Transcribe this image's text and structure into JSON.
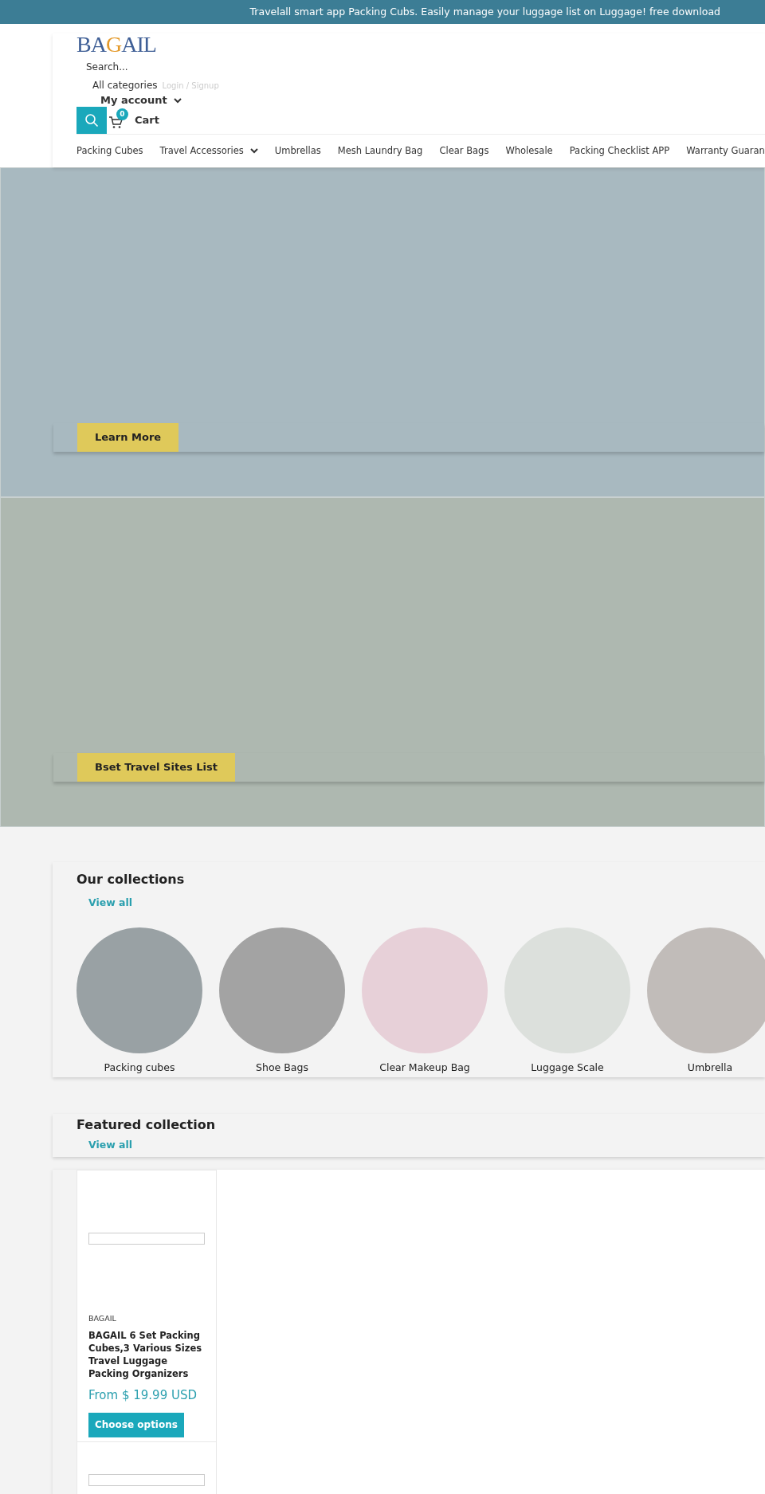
{
  "announcement": "Travelall smart app Packing Cubs. Easily manage your luggage list on Luggage! free download",
  "header": {
    "logo": "BAGAIL",
    "search": {
      "placeholder": "Search..."
    },
    "category_select": "All categories",
    "login": "Login / Signup",
    "account": "My account",
    "cart": {
      "count": "0",
      "label": "Cart"
    }
  },
  "nav": [
    {
      "label": "Packing Cubes",
      "has_menu": false
    },
    {
      "label": "Travel Accessories",
      "has_menu": true
    },
    {
      "label": "Umbrellas",
      "has_menu": false
    },
    {
      "label": "Mesh Laundry Bag",
      "has_menu": false
    },
    {
      "label": "Clear Bags",
      "has_menu": false
    },
    {
      "label": "Wholesale",
      "has_menu": false
    },
    {
      "label": "Packing Checklist APP",
      "has_menu": false
    },
    {
      "label": "Warranty Guaran",
      "has_menu": false
    }
  ],
  "slides": [
    {
      "button": "Learn More",
      "color": "#a8b9c0"
    },
    {
      "button": "Bset Travel Sites List",
      "color": "#aeb8b0"
    }
  ],
  "collections": {
    "title": "Our collections",
    "link": "View all",
    "items": [
      {
        "name": "Packing cubes",
        "color": "#99a1a4"
      },
      {
        "name": "Shoe Bags",
        "color": "#a3a3a3"
      },
      {
        "name": "Clear Makeup Bag",
        "color": "#e7d0d8"
      },
      {
        "name": "Luggage Scale",
        "color": "#dce0dc"
      },
      {
        "name": "Umbrella",
        "color": "#c1bcb9"
      }
    ]
  },
  "featured": {
    "title": "Featured collection",
    "link": "View all",
    "products": [
      {
        "vendor": "BAGAIL",
        "title": "BAGAIL 6 Set Packing Cubes,3 Various Sizes Travel Luggage Packing Organizers",
        "price": "From $ 19.99 USD",
        "button": "Choose options"
      }
    ]
  }
}
